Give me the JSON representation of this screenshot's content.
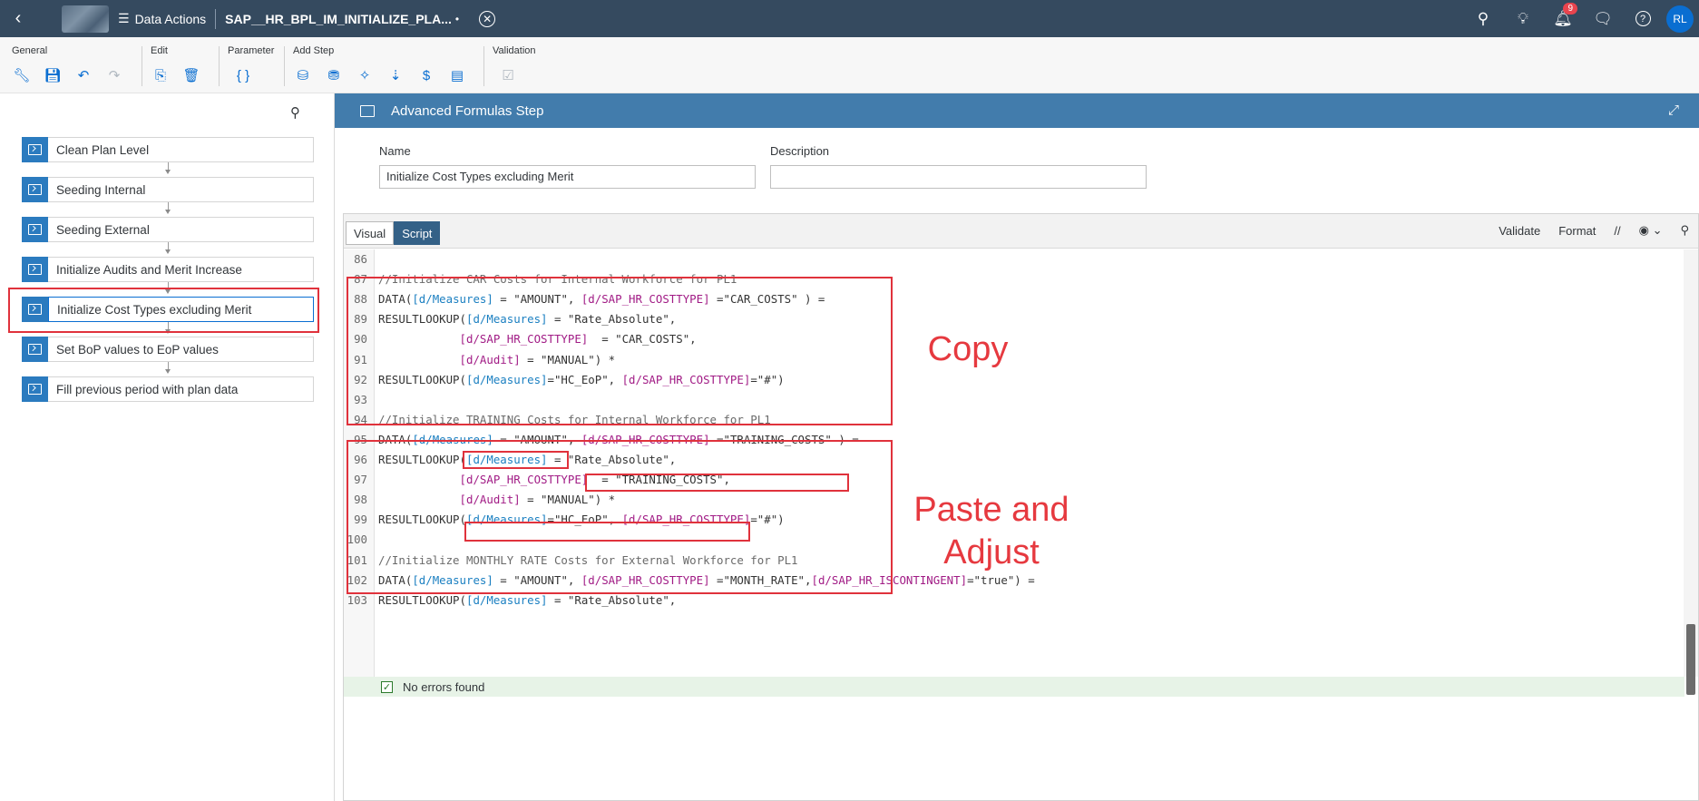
{
  "shell": {
    "back_icon": "chevron-left-icon",
    "nav_label": "Data Actions",
    "title": "SAP__HR_BPL_IM_INITIALIZE_PLA...",
    "dirty_marker": "•",
    "notification_count": "9",
    "avatar_initials": "RL"
  },
  "toolbar": {
    "general_label": "General",
    "edit_label": "Edit",
    "parameter_label": "Parameter",
    "add_step_label": "Add Step",
    "validation_label": "Validation"
  },
  "steps": [
    {
      "label": "Clean Plan Level"
    },
    {
      "label": "Seeding Internal"
    },
    {
      "label": "Seeding External"
    },
    {
      "label": "Initialize Audits and Merit Increase"
    },
    {
      "label": "Initialize Cost Types excluding Merit"
    },
    {
      "label": "Set BoP values to EoP values"
    },
    {
      "label": "Fill previous period with plan data"
    }
  ],
  "panel": {
    "title": "Advanced Formulas Step"
  },
  "form": {
    "name_label": "Name",
    "name_value": "Initialize Cost Types excluding Merit",
    "description_label": "Description",
    "description_value": ""
  },
  "editor": {
    "tab_visual": "Visual",
    "tab_script": "Script",
    "validate_label": "Validate",
    "format_label": "Format",
    "comment_label": "//"
  },
  "code_lines": [
    {
      "n": "86",
      "text": ""
    },
    {
      "n": "87",
      "text": "//Initialize CAR Costs for Internal Workforce for PL1"
    },
    {
      "n": "88",
      "text": "DATA([d/Measures] = \"AMOUNT\", [d/SAP_HR_COSTTYPE] =\"CAR_COSTS\" ) ="
    },
    {
      "n": "89",
      "text": "RESULTLOOKUP([d/Measures] = \"Rate_Absolute\","
    },
    {
      "n": "90",
      "text": "            [d/SAP_HR_COSTTYPE]  = \"CAR_COSTS\","
    },
    {
      "n": "91",
      "text": "            [d/Audit] = \"MANUAL\") *"
    },
    {
      "n": "92",
      "text": "RESULTLOOKUP([d/Measures]=\"HC_EoP\", [d/SAP_HR_COSTTYPE]=\"#\")"
    },
    {
      "n": "93",
      "text": ""
    },
    {
      "n": "94",
      "text": "//Initialize TRAINING Costs for Internal Workforce for PL1"
    },
    {
      "n": "95",
      "text": "DATA([d/Measures] = \"AMOUNT\", [d/SAP_HR_COSTTYPE] =\"TRAINING_COSTS\" ) ="
    },
    {
      "n": "96",
      "text": "RESULTLOOKUP([d/Measures] = \"Rate_Absolute\","
    },
    {
      "n": "97",
      "text": "            [d/SAP_HR_COSTTYPE]  = \"TRAINING_COSTS\","
    },
    {
      "n": "98",
      "text": "            [d/Audit] = \"MANUAL\") *"
    },
    {
      "n": "99",
      "text": "RESULTLOOKUP([d/Measures]=\"HC_EoP\", [d/SAP_HR_COSTTYPE]=\"#\")"
    },
    {
      "n": "100",
      "text": ""
    },
    {
      "n": "101",
      "text": "//Initialize MONTHLY RATE Costs for External Workforce for PL1"
    },
    {
      "n": "102",
      "text": "DATA([d/Measures] = \"AMOUNT\", [d/SAP_HR_COSTTYPE] =\"MONTH_RATE\",[d/SAP_HR_ISCONTINGENT]=\"true\") ="
    },
    {
      "n": "103",
      "text": "RESULTLOOKUP([d/Measures] = \"Rate_Absolute\","
    }
  ],
  "status": {
    "message": "No errors found"
  },
  "annotations": {
    "copy": "Copy",
    "paste_line1": "Paste and",
    "paste_line2": "Adjust"
  },
  "colors": {
    "shell_bg": "#354a5f",
    "header_bg": "#427cac",
    "annotation_red": "#e0323c",
    "accent_blue": "#0a6ed1"
  }
}
